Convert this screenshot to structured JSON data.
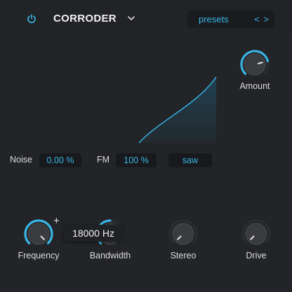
{
  "header": {
    "module_name": "CORRODER",
    "presets_label": "presets",
    "prev_glyph": "<",
    "next_glyph": ">"
  },
  "params": {
    "noise_label": "Noise",
    "noise_value": "0.00 %",
    "fm_label": "FM",
    "fm_value": "100 %",
    "waveform_value": "saw"
  },
  "knobs": {
    "amount": {
      "label": "Amount",
      "level": 0.78
    },
    "frequency": {
      "label": "Frequency",
      "level": 1.0
    },
    "bandwidth": {
      "label": "Bandwidth",
      "level": 0.5
    },
    "stereo": {
      "label": "Stereo",
      "level": 0.0
    },
    "drive": {
      "label": "Drive",
      "level": 0.0
    }
  },
  "tooltip": {
    "text": "18000 Hz",
    "plus": "+"
  },
  "colors": {
    "accent": "#38b6e8",
    "background": "#232427",
    "value_box": "#18191c",
    "knob_body": "#3a3b3f"
  },
  "icons": [
    "power-icon",
    "chevron-down-icon"
  ]
}
